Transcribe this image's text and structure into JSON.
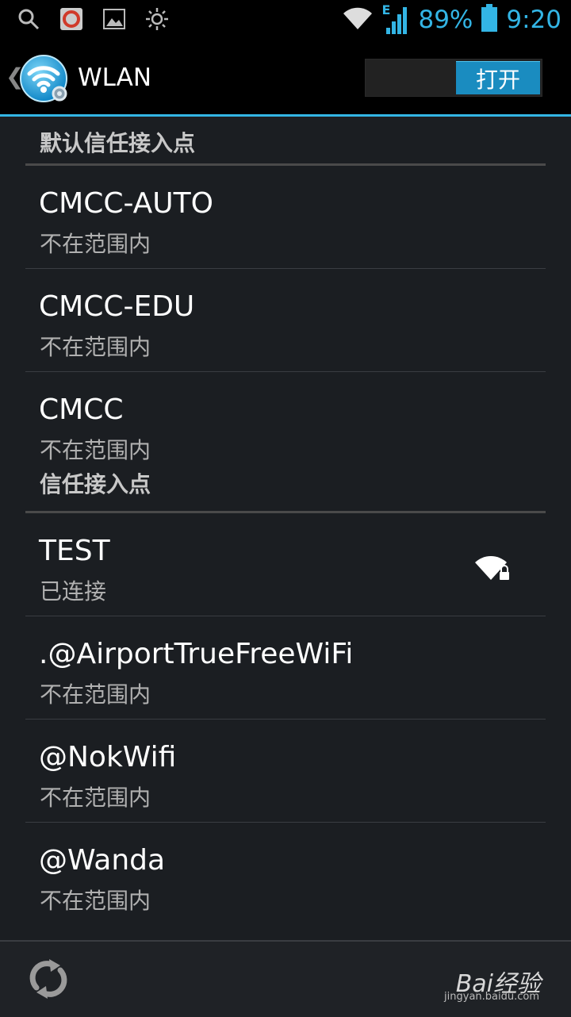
{
  "status_bar": {
    "icons": [
      "search-icon",
      "app-notification-icon",
      "image-icon",
      "brightness-icon"
    ],
    "network_type": "E",
    "battery_percent": "89%",
    "time": "9:20",
    "accent_color": "#33b5e5"
  },
  "action_bar": {
    "title": "WLAN",
    "toggle_label": "打开"
  },
  "sections": [
    {
      "header": "默认信任接入点",
      "networks": [
        {
          "ssid": "CMCC-AUTO",
          "status": "不在范围内"
        },
        {
          "ssid": "CMCC-EDU",
          "status": "不在范围内"
        },
        {
          "ssid": "CMCC",
          "status": "不在范围内"
        }
      ]
    },
    {
      "header": "信任接入点",
      "networks": [
        {
          "ssid": "TEST",
          "status": "已连接",
          "signal_icon": "wifi-lock-icon"
        },
        {
          "ssid": ".@AirportTrueFreeWiFi",
          "status": "不在范围内"
        },
        {
          "ssid": "@NokWifi",
          "status": "不在范围内"
        },
        {
          "ssid": "@Wanda",
          "status": "不在范围内"
        }
      ]
    }
  ],
  "bottom_bar": {
    "watermark": "Bai经验",
    "watermark_url": "jingyan.baidu.com"
  }
}
